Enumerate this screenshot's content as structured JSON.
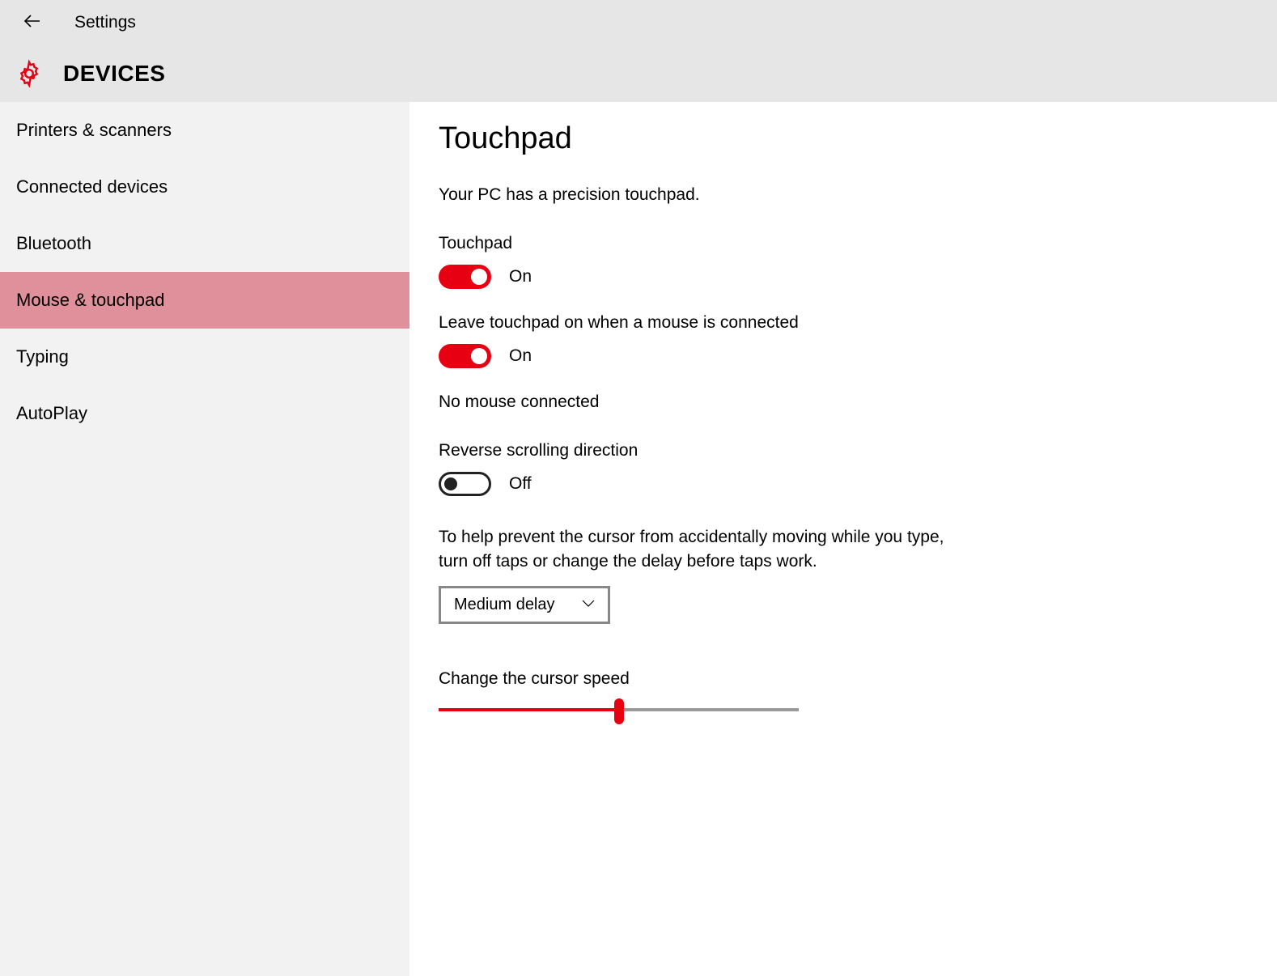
{
  "header": {
    "back": "←",
    "title": "Settings"
  },
  "category": {
    "title": "DEVICES",
    "accent": "#e60012"
  },
  "sidebar": {
    "items": [
      {
        "label": "Printers & scanners",
        "selected": false
      },
      {
        "label": "Connected devices",
        "selected": false
      },
      {
        "label": "Bluetooth",
        "selected": false
      },
      {
        "label": "Mouse & touchpad",
        "selected": true
      },
      {
        "label": "Typing",
        "selected": false
      },
      {
        "label": "AutoPlay",
        "selected": false
      }
    ]
  },
  "main": {
    "title": "Touchpad",
    "info": "Your PC has a precision touchpad.",
    "touchpad_label": "Touchpad",
    "touchpad_toggle": {
      "on": true,
      "text": "On"
    },
    "leave_on_label": "Leave touchpad on when a mouse is connected",
    "leave_on_toggle": {
      "on": true,
      "text": "On"
    },
    "mouse_status": "No mouse connected",
    "reverse_label": "Reverse scrolling direction",
    "reverse_toggle": {
      "on": false,
      "text": "Off"
    },
    "help_text": "To help prevent the cursor from accidentally moving while you type, turn off taps or change the delay before taps work.",
    "delay_dropdown": {
      "value": "Medium delay"
    },
    "cursor_speed_label": "Change the cursor speed",
    "cursor_speed": {
      "percent": 50
    }
  }
}
